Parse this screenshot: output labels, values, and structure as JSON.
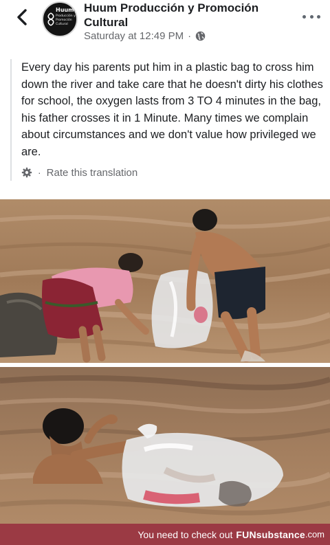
{
  "post": {
    "page_name": "Huum Producción y Promoción Cultural",
    "timestamp": "Saturday at 12:49 PM",
    "separator": "·",
    "audience_icon": "globe-icon",
    "avatar": {
      "org": "Huum",
      "org_sub": "Producción y Promoción Cultural"
    },
    "text": "Every day his parents put him in a plastic bag to cross him down the river and take care that he doesn't dirty his clothes for school, the oxygen lasts from 3 TO 4 minutes in the bag, his father crosses it in 1 Minute. Many times we complain about circumstances and we don't value how privileged we are.",
    "translation": {
      "separator": "·",
      "rate_label": "Rate this translation"
    }
  },
  "photos": [
    {
      "subject": "photo-parents-river"
    },
    {
      "subject": "photo-father-swimming"
    }
  ],
  "footer": {
    "text": "You need to check out",
    "brand": "FUNsubstance",
    "tld": ".com"
  },
  "colors": {
    "text": "#1c1e21",
    "muted": "#65676b",
    "footer_bg": "#9b3a44",
    "river": "#a9835f"
  }
}
